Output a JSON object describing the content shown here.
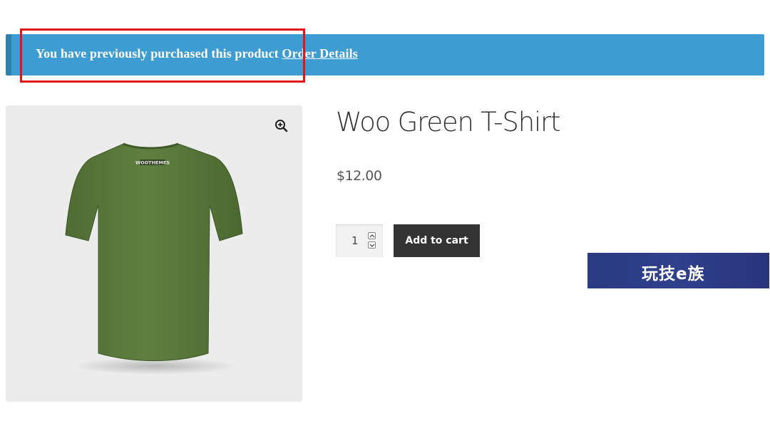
{
  "notice": {
    "message": "You have previously purchased this product",
    "link_label": "Order Details",
    "background_color": "#3d9cd2"
  },
  "annotation": {
    "color": "#e01515"
  },
  "gallery": {
    "zoom_icon": "zoom-in-icon",
    "image_subject": "green t-shirt back view",
    "shirt_color": "#5b7a3c",
    "brand_mark": "WOOTHEMES"
  },
  "product": {
    "title": "Woo Green T-Shirt",
    "price": "$12.00"
  },
  "cart": {
    "quantity": "1",
    "add_label": "Add to cart"
  },
  "watermark": {
    "text": "玩技e族"
  }
}
